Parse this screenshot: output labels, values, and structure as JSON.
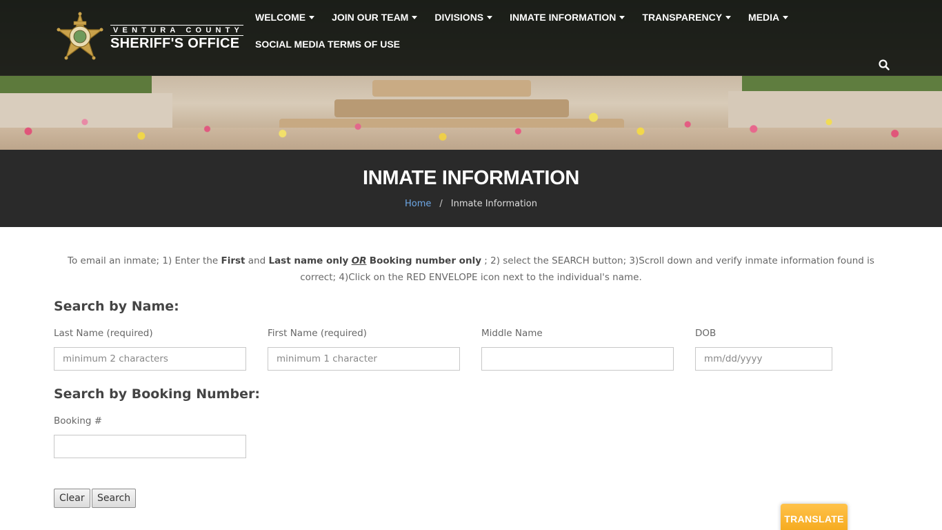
{
  "header": {
    "logo_county": "VENTURA COUNTY",
    "logo_office": "SHERIFF'S OFFICE",
    "nav_row1": [
      {
        "label": "WELCOME",
        "dropdown": true
      },
      {
        "label": "JOIN OUR TEAM",
        "dropdown": true
      },
      {
        "label": "DIVISIONS",
        "dropdown": true
      },
      {
        "label": "INMATE INFORMATION",
        "dropdown": true
      },
      {
        "label": "TRANSPARENCY",
        "dropdown": true
      },
      {
        "label": "MEDIA",
        "dropdown": true
      }
    ],
    "nav_row2": [
      {
        "label": "SOCIAL MEDIA TERMS OF USE",
        "dropdown": false
      }
    ],
    "search_icon": "search-icon"
  },
  "title_band": {
    "title": "INMATE INFORMATION",
    "breadcrumb_home": "Home",
    "breadcrumb_sep": "/",
    "breadcrumb_current": "Inmate Information"
  },
  "instructions": {
    "p1": "To email an inmate; 1) Enter the ",
    "b1": "First",
    "p2": " and ",
    "b2": "Last name only",
    "or": "OR",
    "b3": "Booking number only",
    "p3": " ; 2) select the SEARCH button;  3)Scroll down and verify inmate information found is correct; 4)Click on the RED ENVELOPE icon next to the individual's name."
  },
  "search_by_name": {
    "heading": "Search by Name:",
    "last_name_label": "Last Name (required)",
    "last_name_placeholder": "minimum 2 characters",
    "first_name_label": "First Name (required)",
    "first_name_placeholder": "minimum 1 character",
    "middle_name_label": "Middle Name",
    "middle_name_placeholder": "",
    "dob_label": "DOB",
    "dob_placeholder": "mm/dd/yyyy"
  },
  "search_by_booking": {
    "heading": "Search by Booking Number:",
    "booking_label": "Booking #",
    "booking_placeholder": ""
  },
  "buttons": {
    "clear": "Clear",
    "search": "Search",
    "translate": "TRANSLATE"
  },
  "colors": {
    "nav_text": "#ffffff",
    "title_band_bg": "#2a2a2a",
    "breadcrumb_link": "#6ea8e6",
    "translate_bg": "#f5a91c"
  }
}
